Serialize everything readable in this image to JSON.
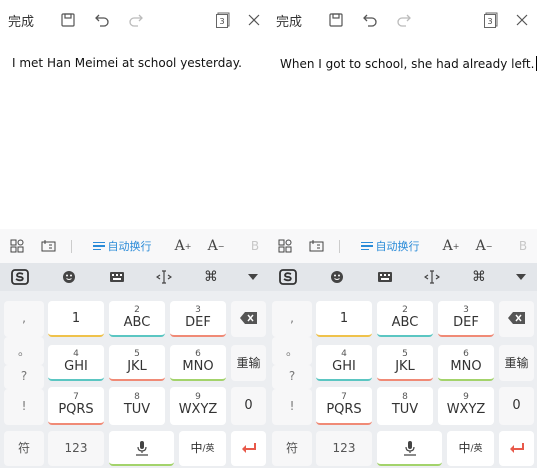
{
  "panes": [
    {
      "id": "left",
      "toolbar": {
        "done_label": "完成",
        "page_count": "3"
      },
      "note_text": "I met Han Meimei at school yesterday.",
      "keyboard": {
        "toolbar": {
          "wrap_label": "自动换行",
          "font_up_label": "A",
          "font_down_label": "A",
          "bold_label": "B"
        },
        "punct": [
          ",",
          "。",
          "?",
          "!"
        ],
        "keys": [
          {
            "num": "",
            "letters": "1"
          },
          {
            "num": "2",
            "letters": "ABC"
          },
          {
            "num": "3",
            "letters": "DEF"
          },
          {
            "num": "4",
            "letters": "GHI"
          },
          {
            "num": "5",
            "letters": "JKL"
          },
          {
            "num": "6",
            "letters": "MNO"
          },
          {
            "num": "7",
            "letters": "PQRS"
          },
          {
            "num": "8",
            "letters": "TUV"
          },
          {
            "num": "9",
            "letters": "WXYZ"
          }
        ],
        "reenter_label": "重输",
        "zero_label": "0",
        "symbol_label": "符",
        "numeric_label": "123",
        "lang_label_main": "中",
        "lang_label_sub": "/英"
      }
    },
    {
      "id": "right",
      "toolbar": {
        "done_label": "完成",
        "page_count": "3"
      },
      "note_text": "When I got to school, she had already left.",
      "keyboard": {
        "toolbar": {
          "wrap_label": "自动换行",
          "font_up_label": "A",
          "font_down_label": "A",
          "bold_label": "B"
        },
        "punct": [
          ",",
          "。",
          "?",
          "!"
        ],
        "keys": [
          {
            "num": "",
            "letters": "1"
          },
          {
            "num": "2",
            "letters": "ABC"
          },
          {
            "num": "3",
            "letters": "DEF"
          },
          {
            "num": "4",
            "letters": "GHI"
          },
          {
            "num": "5",
            "letters": "JKL"
          },
          {
            "num": "6",
            "letters": "MNO"
          },
          {
            "num": "7",
            "letters": "PQRS"
          },
          {
            "num": "8",
            "letters": "TUV"
          },
          {
            "num": "9",
            "letters": "WXYZ"
          }
        ],
        "reenter_label": "重输",
        "zero_label": "0",
        "symbol_label": "符",
        "numeric_label": "123",
        "lang_label_main": "中",
        "lang_label_sub": "/英"
      }
    }
  ],
  "icons": {
    "save": "save-icon",
    "undo": "undo-icon",
    "redo": "redo-icon",
    "pages": "page-count-icon",
    "close": "close-icon",
    "sogou": "sogou-logo-icon",
    "emoji": "emoji-icon",
    "keyboard": "keyboard-icon",
    "cursor": "cursor-move-icon",
    "command": "command-icon",
    "collapse": "collapse-keyboard-icon",
    "backspace": "backspace-icon",
    "mic": "microphone-icon",
    "enter": "enter-icon"
  },
  "colors": {
    "accent": "#2a8bd8",
    "enter": "#e8594a",
    "underline_yellow": "#efc24b",
    "underline_teal": "#5bc6c2",
    "underline_red": "#f08a76",
    "underline_green": "#a3d36b"
  }
}
